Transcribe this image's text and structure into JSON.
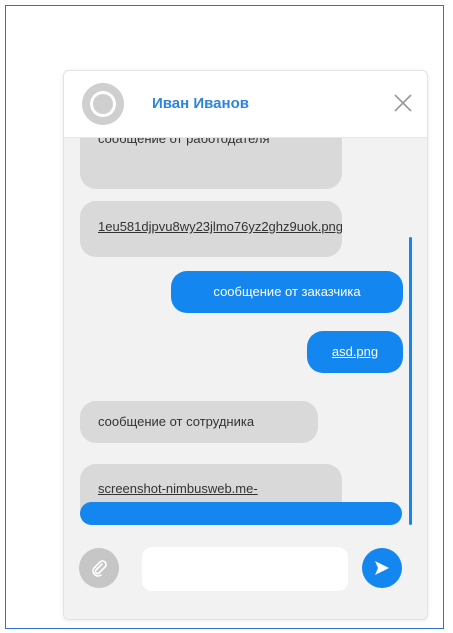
{
  "header": {
    "user_name": "Иван Иванов"
  },
  "messages": [
    {
      "side": "in",
      "text": "сообщение от работодателя"
    },
    {
      "side": "in",
      "text": "1eu581djpvu8wy23jlmo76yz2ghz9uok.png",
      "is_link": true
    },
    {
      "side": "out",
      "text": "сообщение от заказчика"
    },
    {
      "side": "out",
      "text": "asd.png",
      "is_link": true
    },
    {
      "side": "in",
      "text": "сообщение от сотрудника"
    },
    {
      "side": "in",
      "text": "screenshot-nimbusweb.me-",
      "is_link": true
    }
  ],
  "composer": {
    "input_value": "",
    "input_placeholder": ""
  },
  "icons": {
    "avatar": "user-avatar-icon",
    "close": "close-icon",
    "attach": "paperclip-icon",
    "send": "send-arrow-icon"
  },
  "colors": {
    "accent": "#1486ef",
    "name": "#2c84e0",
    "incoming_bubble": "#d9d9d9",
    "frame_border": "#2f6fd6"
  }
}
